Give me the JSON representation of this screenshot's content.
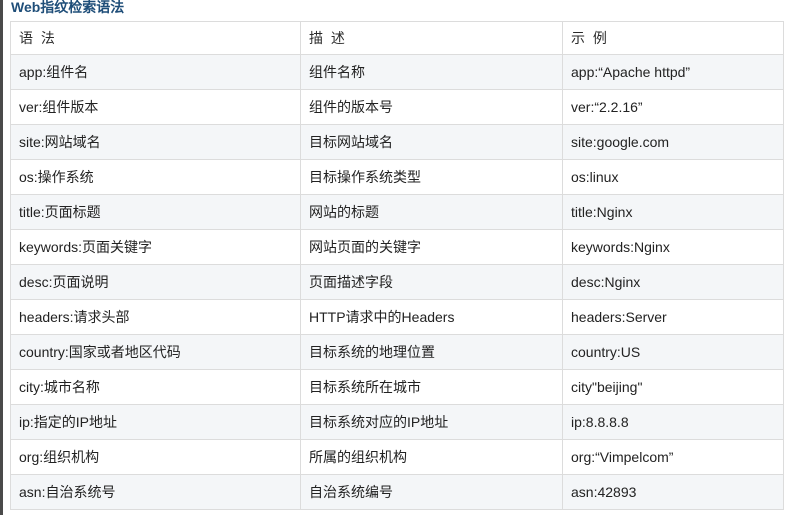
{
  "section": {
    "title": "Web指纹检索语法"
  },
  "table": {
    "headers": [
      "语 法",
      "描 述",
      "示 例"
    ],
    "rows": [
      [
        "app:组件名",
        "组件名称",
        "app:“Apache httpd”"
      ],
      [
        "ver:组件版本",
        "组件的版本号",
        "ver:“2.2.16”"
      ],
      [
        "site:网站域名",
        "目标网站域名",
        "site:google.com"
      ],
      [
        "os:操作系统",
        "目标操作系统类型",
        "os:linux"
      ],
      [
        "title:页面标题",
        "网站的标题",
        "title:Nginx"
      ],
      [
        "keywords:页面关键字",
        "网站页面的关键字",
        "keywords:Nginx"
      ],
      [
        "desc:页面说明",
        "页面描述字段",
        "desc:Nginx"
      ],
      [
        "headers:请求头部",
        "HTTP请求中的Headers",
        "headers:Server"
      ],
      [
        "country:国家或者地区代码",
        "目标系统的地理位置",
        "country:US"
      ],
      [
        "city:城市名称",
        "目标系统所在城市",
        "city\"beijing\""
      ],
      [
        "ip:指定的IP地址",
        "目标系统对应的IP地址",
        "ip:8.8.8.8"
      ],
      [
        "org:组织机构",
        "所属的组织机构",
        "org:“Vimpelcom”"
      ],
      [
        "asn:自治系统号",
        "自治系统编号",
        "asn:42893"
      ]
    ]
  },
  "colors": {
    "heading": "#1f4e79",
    "border": "#dcdcdc",
    "row_alt": "#f4f6f8"
  }
}
